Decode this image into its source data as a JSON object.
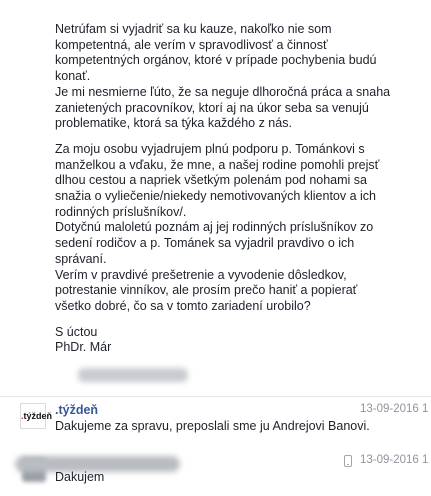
{
  "post": {
    "paragraph1": [
      "Netrúfam si vyjadriť sa ku kauze, nakoľko nie som",
      "kompetentná, ale verím v spravodlivosť a činnosť",
      "kompetentných orgánov, ktoré v prípade pochybenia budú",
      "konať.",
      "Je mi nesmierne ľúto, že sa neguje dlhoročná práca a snaha",
      "zanietených pracovníkov, ktorí aj na úkor seba sa venujú",
      "problematike, ktorá sa týka každého z nás."
    ],
    "paragraph2": [
      "Za moju osobu vyjadrujem plnú podporu p. Tománkovi s",
      "manželkou a vďaku, že mne, a našej rodine pomohli prejsť",
      "dlhou cestou a napriek všetkým polenám pod nohami sa",
      "snažia o vyliečenie/niekedy nemotivovaných klientov a ich",
      "rodinných príslušníkov/.",
      "Dotyčnú maloletú poznám aj jej rodinných príslušníkov zo",
      "sedení rodičov a p. Tománek sa vyjadril pravdivo o ich",
      "správaní.",
      "Verím v pravdivé prešetrenie a vyvodenie dôsledkov,",
      "potrestanie vinníkov, ale prosím prečo haniť a popierať",
      "všetko dobré, čo sa v tomto zariadení urobilo?"
    ],
    "closing": "S úctou",
    "signature": "PhDr. Már"
  },
  "comments": [
    {
      "logo_text": "týždeň",
      "logo_dot": ".",
      "author": ".týždeň",
      "time": "13-09-2016 1",
      "text": "Dakujeme za spravu, preposlali sme ju Andrejovi Banovi."
    },
    {
      "author": "",
      "time": "13-09-2016 1",
      "text": "Dakujem"
    }
  ],
  "colors": {
    "text": "#1d2129",
    "link": "#365899",
    "meta": "#90949c",
    "logo_accent": "#d21f1f"
  },
  "icons": [
    "phone-icon"
  ]
}
